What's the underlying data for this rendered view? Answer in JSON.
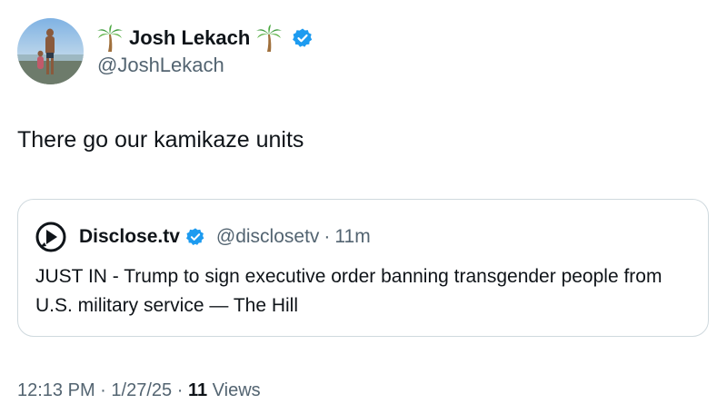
{
  "author": {
    "display_name": "Josh Lekach",
    "handle": "@JoshLekach",
    "name_emoji": "palm-tree-icon",
    "verified_icon": "verified-badge-icon",
    "avatar": "profile-photo"
  },
  "tweet": {
    "text": "There go our kamikaze units"
  },
  "quoted_tweet": {
    "display_name": "Disclose.tv",
    "handle": "@disclosetv",
    "separator": "·",
    "time": "11m",
    "text": "JUST IN - Trump to sign executive order banning transgender people from U.S. military service — The Hill",
    "avatar_icon": "disclose-logo-icon",
    "verified_icon": "verified-badge-icon"
  },
  "metadata": {
    "time": "12:13 PM",
    "separator": "·",
    "date": "1/27/25",
    "views_count": "11",
    "views_label": "Views"
  },
  "colors": {
    "text_primary": "#0f1419",
    "text_secondary": "#536471",
    "verified_blue": "#1d9bf0",
    "border": "#cfd9de"
  }
}
